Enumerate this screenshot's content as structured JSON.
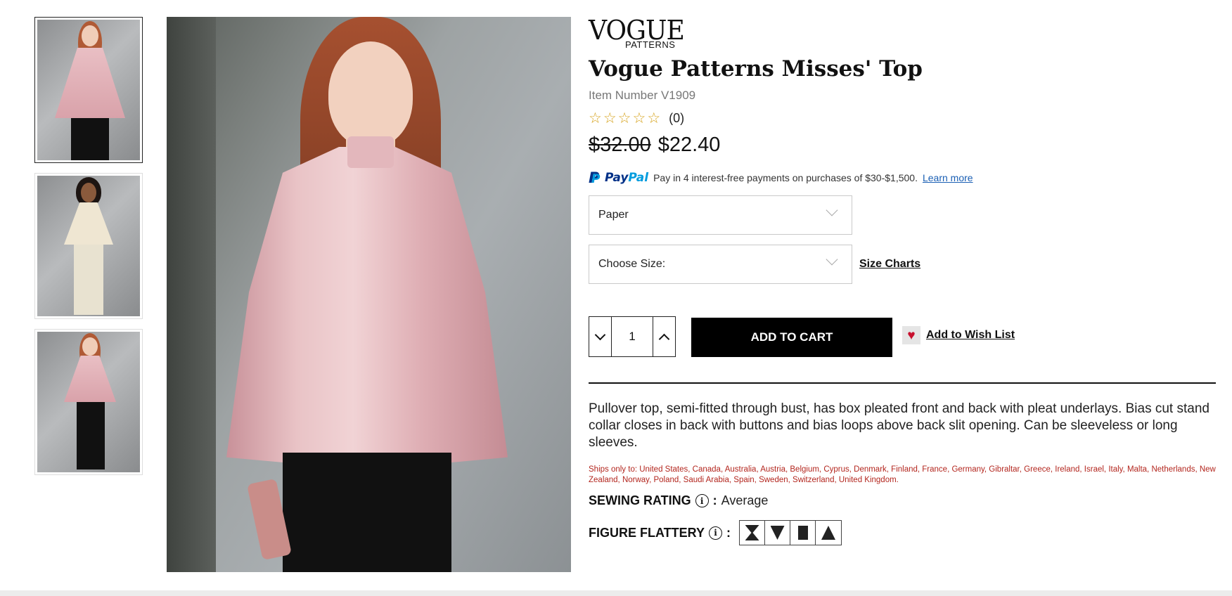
{
  "brand": {
    "name": "VOGUE",
    "sub": "PATTERNS"
  },
  "product": {
    "title": "Vogue Patterns Misses' Top",
    "item_number": "Item Number V1909",
    "rating_count": "(0)",
    "star_count": 5,
    "price_old": "$32.00",
    "price_new": "$22.40"
  },
  "paypal": {
    "text": "Pay in 4 interest-free payments on purchases of $30-$1,500.",
    "link": "Learn more"
  },
  "options": {
    "format_selected": "Paper",
    "size_selected": "Choose Size:",
    "size_charts_link": "Size Charts"
  },
  "cart": {
    "quantity": "1",
    "add_to_cart": "ADD TO CART",
    "wishlist": "Add to Wish List"
  },
  "description": "Pullover top, semi-fitted through bust, has box pleated front and back with pleat underlays. Bias cut stand collar closes in back with buttons and bias loops above back slit opening. Can be sleeveless or long sleeves.",
  "shipping": "Ships only to: United States, Canada, Australia, Austria, Belgium, Cyprus, Denmark, Finland, France, Germany, Gibraltar, Greece, Ireland, Israel, Italy, Malta, Netherlands, New Zealand, Norway, Poland, Saudi Arabia, Spain, Sweden, Switzerland, United Kingdom.",
  "sewing_rating": {
    "label": "SEWING RATING",
    "value": "Average"
  },
  "figure_flattery": {
    "label": "FIGURE FLATTERY",
    "shapes": [
      "hourglass-icon",
      "inverted-triangle-icon",
      "rectangle-icon",
      "triangle-icon"
    ]
  },
  "colors": {
    "accent_red": "#c8102e",
    "paypal_blue": "#003087",
    "paypal_light": "#009cde",
    "link_blue": "#1a5fb4"
  }
}
